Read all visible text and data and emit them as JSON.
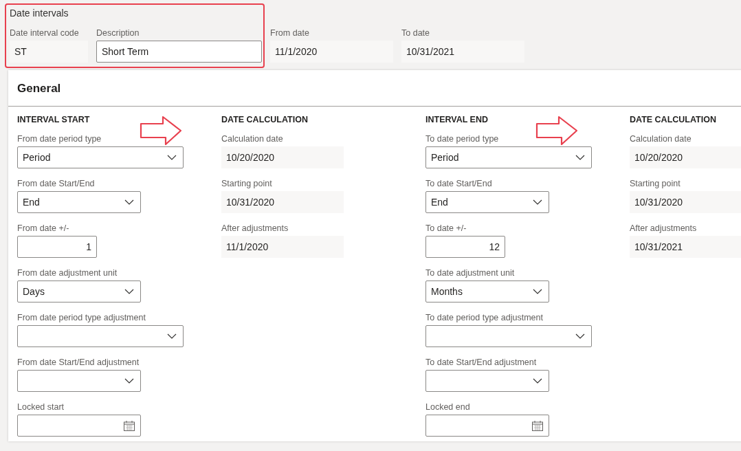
{
  "header": {
    "title": "Date intervals",
    "fields": [
      {
        "label": "Date interval code",
        "value": "ST",
        "kind": "readonly"
      },
      {
        "label": "Description",
        "value": "Short Term",
        "kind": "text"
      },
      {
        "label": "From date",
        "value": "11/1/2020",
        "kind": "readonly"
      },
      {
        "label": "To date",
        "value": "10/31/2021",
        "kind": "readonly"
      }
    ]
  },
  "card": {
    "title": "General",
    "columns": [
      {
        "heading": "INTERVAL START",
        "fields": [
          {
            "label": "From date period type",
            "value": "Period",
            "kind": "select"
          },
          {
            "label": "From date Start/End",
            "value": "End",
            "kind": "select"
          },
          {
            "label": "From date +/-",
            "value": "1",
            "kind": "number"
          },
          {
            "label": "From date adjustment unit",
            "value": "Days",
            "kind": "select"
          },
          {
            "label": "From date period type adjustment",
            "kind": "select"
          },
          {
            "label": "From date Start/End adjustment",
            "kind": "select"
          },
          {
            "label": "Locked start",
            "kind": "date"
          }
        ]
      },
      {
        "heading": "DATE CALCULATION",
        "fields": [
          {
            "label": "Calculation date",
            "value": "10/20/2020",
            "kind": "readonly"
          },
          {
            "label": "Starting point",
            "value": "10/31/2020",
            "kind": "readonly"
          },
          {
            "label": "After adjustments",
            "value": "11/1/2020",
            "kind": "readonly"
          }
        ]
      },
      {
        "heading": "INTERVAL END",
        "fields": [
          {
            "label": "To date period type",
            "value": "Period",
            "kind": "select"
          },
          {
            "label": "To date Start/End",
            "value": "End",
            "kind": "select"
          },
          {
            "label": "To date +/-",
            "value": "12",
            "kind": "number"
          },
          {
            "label": "To date adjustment unit",
            "value": "Months",
            "kind": "select"
          },
          {
            "label": "To date period type adjustment",
            "kind": "select"
          },
          {
            "label": "To date Start/End adjustment",
            "kind": "select"
          },
          {
            "label": "Locked end",
            "kind": "date"
          }
        ]
      },
      {
        "heading": "DATE CALCULATION",
        "fields": [
          {
            "label": "Calculation date",
            "value": "10/20/2020",
            "kind": "readonly"
          },
          {
            "label": "Starting point",
            "value": "10/31/2020",
            "kind": "readonly"
          },
          {
            "label": "After adjustments",
            "value": "10/31/2021",
            "kind": "readonly"
          }
        ]
      }
    ]
  }
}
